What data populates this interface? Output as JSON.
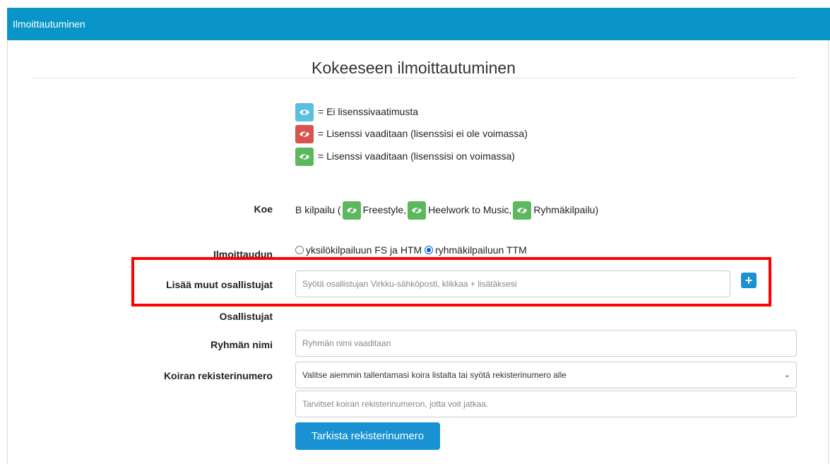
{
  "header": {
    "title": "Ilmoittautuminen"
  },
  "page": {
    "heading": "Kokeeseen ilmoittautuminen"
  },
  "legend": [
    {
      "icon": "eye-icon",
      "color": "#5bc0de",
      "text": "= Ei lisenssivaatimusta"
    },
    {
      "icon": "eye-slash-icon",
      "color": "#d9534f",
      "text": "= Lisenssi vaaditaan (lisenssisi ei ole voimassa)"
    },
    {
      "icon": "eye-slash-icon",
      "color": "#5cb85c",
      "text": "= Lisenssi vaaditaan (lisenssisi on voimassa)"
    }
  ],
  "koe": {
    "label": "Koe",
    "prefix": "B kilpailu (",
    "items": [
      "Freestyle,",
      "Heelwork to Music,",
      "Ryhmäkilpailu)"
    ]
  },
  "ilmoittaudun": {
    "label": "Ilmoittaudun",
    "options": [
      "yksilökilpailuun FS ja HTM",
      "ryhmäkilpailuun TTM"
    ],
    "selected": "ryhmäkilpailuun TTM"
  },
  "participants_add": {
    "label": "Lisää muut osallistujat",
    "placeholder": "Syötä osallistujan Virkku-sähköposti, klikkaa + lisätäksesi",
    "button": "+"
  },
  "participants": {
    "label": "Osallistujat"
  },
  "group_name": {
    "label": "Ryhmän nimi",
    "placeholder": "Ryhmän nimi vaaditaan"
  },
  "dog_reg": {
    "label": "Koiran rekisterinumero",
    "select_value": "Valitse aiemmin tallentamasi koira listalta tai syötä rekisterinumero alle",
    "input_placeholder": "Tarvitset koiran rekisterinumeron, jotta voit jatkaa."
  },
  "check_button": {
    "label": "Tarkista rekisterinumero"
  },
  "colors": {
    "accent": "#1991d2",
    "header": "#0a95c8",
    "highlight": "#ff0000"
  }
}
